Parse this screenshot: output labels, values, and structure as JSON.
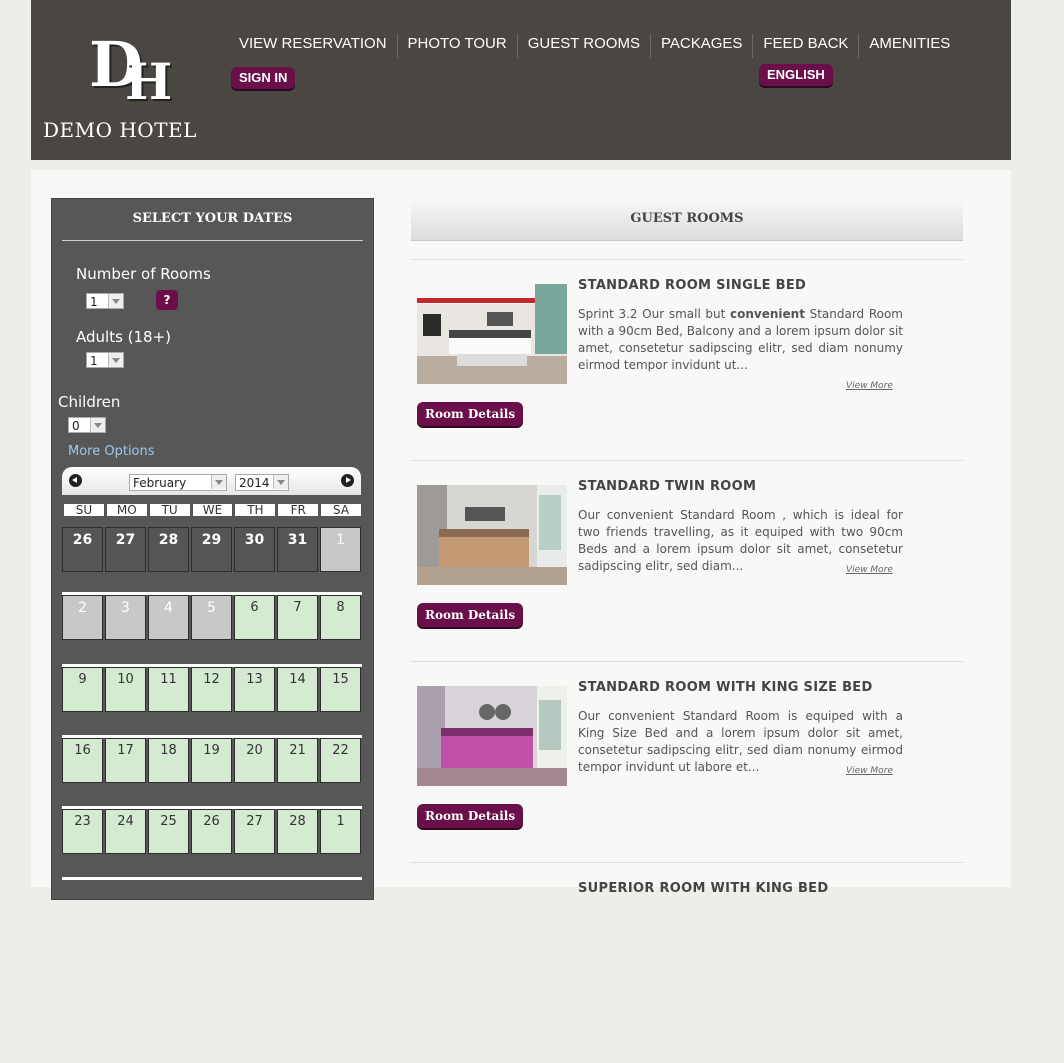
{
  "brand": {
    "monogram_d": "D",
    "monogram_h": "H",
    "name": "DEMO HOTEL"
  },
  "nav": [
    {
      "label": "VIEW RESERVATION"
    },
    {
      "label": "PHOTO TOUR"
    },
    {
      "label": "GUEST ROOMS"
    },
    {
      "label": "PACKAGES"
    },
    {
      "label": "FEED BACK"
    },
    {
      "label": "AMENITIES"
    }
  ],
  "header": {
    "sign_in": "SIGN IN",
    "language": "ENGLISH"
  },
  "sidebar": {
    "title": "SELECT YOUR DATES",
    "rooms_label": "Number of Rooms",
    "rooms_value": "1",
    "help": "?",
    "adults_label": "Adults (18+)",
    "adults_value": "1",
    "children_label": "Children",
    "children_value": "0",
    "more_options": "More Options"
  },
  "calendar": {
    "month": "February",
    "year": "2014",
    "weekdays": [
      "SU",
      "MO",
      "TU",
      "WE",
      "TH",
      "FR",
      "SA"
    ],
    "weeks": [
      [
        "26",
        "27",
        "28",
        "29",
        "30",
        "31",
        "1"
      ],
      [
        "2",
        "3",
        "4",
        "5",
        "6",
        "7",
        "8"
      ],
      [
        "9",
        "10",
        "11",
        "12",
        "13",
        "14",
        "15"
      ],
      [
        "16",
        "17",
        "18",
        "19",
        "20",
        "21",
        "22"
      ],
      [
        "23",
        "24",
        "25",
        "26",
        "27",
        "28",
        "1"
      ]
    ]
  },
  "content": {
    "title": "GUEST ROOMS",
    "rooms": [
      {
        "title": "STANDARD ROOM SINGLE BED",
        "desc_pre": "Sprint 3.2 Our small but ",
        "desc_bold": "convenient",
        "desc_post": " Standard Room with a 90cm Bed, Balcony and a lorem ipsum dolor sit amet, consetetur sadipscing elitr, sed diam nonumy eirmod tempor invidunt ut...",
        "view_more": "View More",
        "button": "Room Details"
      },
      {
        "title": "STANDARD TWIN ROOM",
        "desc_pre": "Our convenient Standard Room , which is ideal for two friends travelling, as it equiped with two 90cm Beds and a lorem ipsum dolor sit amet, consetetur sadipscing elitr, sed diam...",
        "desc_bold": "",
        "desc_post": "",
        "view_more": "View More",
        "button": "Room Details"
      },
      {
        "title": "STANDARD ROOM WITH KING SIZE BED",
        "desc_pre": "Our convenient Standard Room is equiped with a King Size Bed and a lorem ipsum dolor sit amet, consetetur sadipscing elitr, sed diam nonumy eirmod tempor invidunt ut labore et...",
        "desc_bold": "",
        "desc_post": "",
        "view_more": "View More",
        "button": "Room Details"
      },
      {
        "title": "SUPERIOR ROOM WITH KING BED"
      }
    ]
  },
  "colors": {
    "header_bg": "#4a4641",
    "accent": "#6b0f4a",
    "sidebar_bg": "#575757",
    "available_day": "#d4ebd2",
    "link": "#9ec8ea"
  }
}
